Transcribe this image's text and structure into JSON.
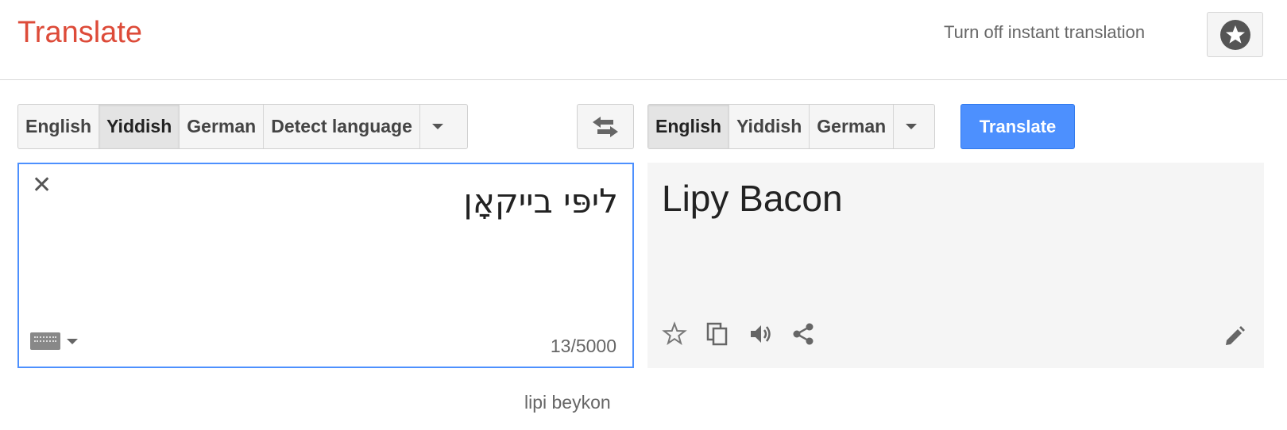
{
  "header": {
    "title": "Translate",
    "instant_link": "Turn off instant translation",
    "starred_icon": "star-icon"
  },
  "source_languages": [
    {
      "label": "English",
      "selected": false
    },
    {
      "label": "Yiddish",
      "selected": true
    },
    {
      "label": "German",
      "selected": false
    },
    {
      "label": "Detect language",
      "selected": false
    }
  ],
  "target_languages": [
    {
      "label": "English",
      "selected": true
    },
    {
      "label": "Yiddish",
      "selected": false
    },
    {
      "label": "German",
      "selected": false
    }
  ],
  "translate_button": "Translate",
  "source": {
    "text": "ליפּי בייקאָן",
    "char_count": "13/5000",
    "clear_icon": "close-icon",
    "keyboard_icon": "keyboard-icon"
  },
  "target": {
    "text": "Lipy Bacon",
    "icons": [
      "star-outline-icon",
      "copy-icon",
      "speaker-icon",
      "share-icon",
      "pencil-icon"
    ]
  },
  "transliteration": "lipi beykon",
  "colors": {
    "title": "#dd4b39",
    "translate_button": "#4d90fe",
    "active_border": "#4d90fe"
  }
}
